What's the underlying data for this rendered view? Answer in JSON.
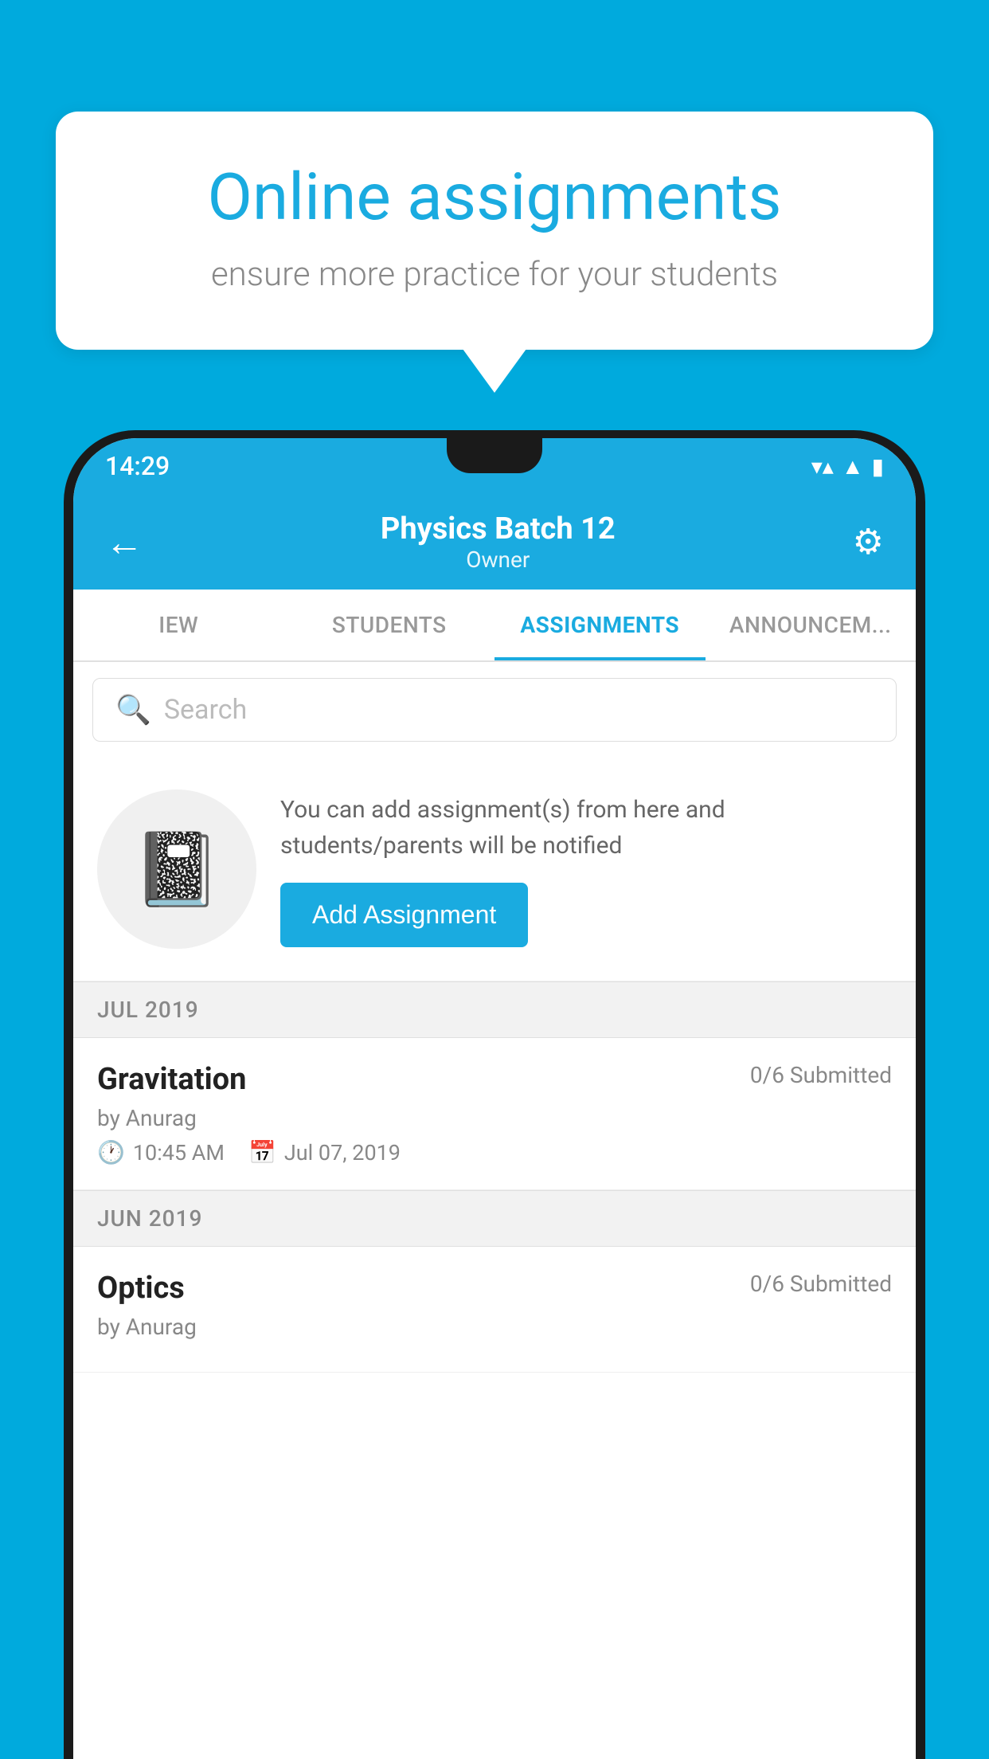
{
  "background_color": "#00AADD",
  "speech_bubble": {
    "title": "Online assignments",
    "subtitle": "ensure more practice for your students"
  },
  "status_bar": {
    "time": "14:29",
    "wifi": "▼",
    "signal": "▲",
    "battery": "▮"
  },
  "header": {
    "title": "Physics Batch 12",
    "subtitle": "Owner",
    "back_label": "←",
    "settings_label": "⚙"
  },
  "tabs": [
    {
      "label": "IEW",
      "active": false
    },
    {
      "label": "STUDENTS",
      "active": false
    },
    {
      "label": "ASSIGNMENTS",
      "active": true
    },
    {
      "label": "ANNOUNCEM...",
      "active": false
    }
  ],
  "search": {
    "placeholder": "Search",
    "icon": "🔍"
  },
  "add_assignment_section": {
    "icon": "📓",
    "description": "You can add assignment(s) from here and students/parents will be notified",
    "button_label": "Add Assignment"
  },
  "assignment_groups": [
    {
      "month": "JUL 2019",
      "assignments": [
        {
          "title": "Gravitation",
          "submitted": "0/6 Submitted",
          "by": "by Anurag",
          "time": "10:45 AM",
          "date": "Jul 07, 2019"
        }
      ]
    },
    {
      "month": "JUN 2019",
      "assignments": [
        {
          "title": "Optics",
          "submitted": "0/6 Submitted",
          "by": "by Anurag",
          "time": "",
          "date": ""
        }
      ]
    }
  ]
}
